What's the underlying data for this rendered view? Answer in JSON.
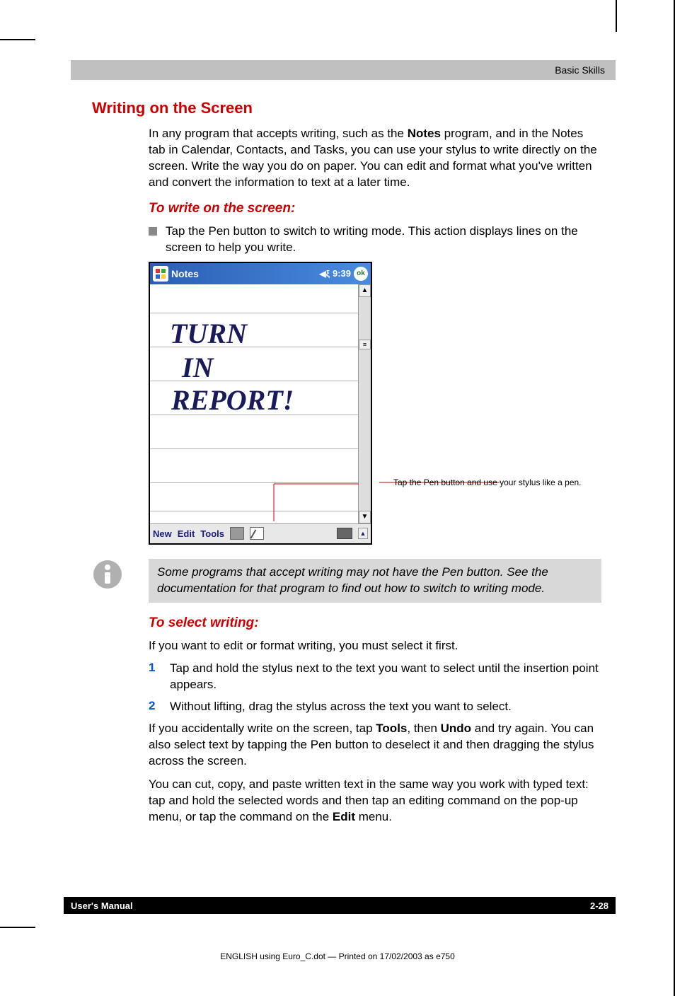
{
  "header": {
    "section": "Basic Skills"
  },
  "title": "Writing on the Screen",
  "intro": {
    "pre": "In any program that accepts writing, such as the ",
    "bold1": "Notes",
    "post": " program, and in the Notes tab in Calendar, Contacts, and Tasks, you can use your stylus to write directly on the screen. Write the way you do on paper. You can edit and format what you've written and convert the information to text at a later time."
  },
  "sub1": "To write on the screen:",
  "bullet1": "Tap the Pen button to switch to writing mode. This action displays lines on the screen to help you write.",
  "pda": {
    "title": "Notes",
    "time": "9:39",
    "ok": "ok",
    "hw_line1": "TURN",
    "hw_line2": "IN",
    "hw_line3": "REPORT!",
    "menu_new": "New",
    "menu_edit": "Edit",
    "menu_tools": "Tools"
  },
  "callout": "Tap the Pen button and use your stylus like a pen.",
  "infobox": "Some programs that accept writing may not have the Pen button. See the documentation for that program to find out how to switch to writing mode.",
  "sub2": "To select writing:",
  "p_select_intro": "If you want to edit or format writing, you must select it first.",
  "step1_num": "1",
  "step1": "Tap and hold the stylus next to the text you want to select until the insertion point appears.",
  "step2_num": "2",
  "step2": "Without lifting, drag the stylus across the text you want to select.",
  "p_undo": {
    "pre": "If you accidentally write on the screen, tap ",
    "b1": "Tools",
    "mid1": ", then ",
    "b2": "Undo",
    "post": " and try again. You can also select text by tapping the Pen button to deselect it and then dragging the stylus across the screen."
  },
  "p_cut": {
    "pre": "You can cut, copy, and paste written text in the same way you work with typed text: tap and hold the selected words and then tap an editing command on the pop-up menu, or tap the command on the ",
    "b1": "Edit",
    "post": " menu."
  },
  "footer": {
    "left": "User's Manual",
    "right": "2-28"
  },
  "printline": "ENGLISH using Euro_C.dot — Printed on 17/02/2003 as e750"
}
